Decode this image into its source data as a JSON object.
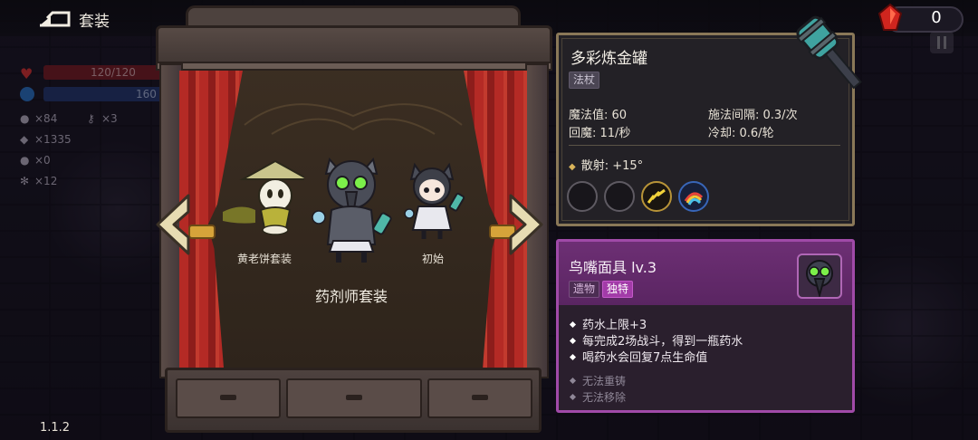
{
  "header": {
    "title": "套装",
    "gem_count": "0"
  },
  "hud": {
    "hp_text": "120/120",
    "mp_text": "160",
    "coins": "×84",
    "keys": "×3",
    "gems": "×1335",
    "potions": "×0",
    "other": "×12"
  },
  "version": "1.1.2",
  "stage": {
    "left_char_label": "黄老饼套装",
    "right_char_label": "初始",
    "current_set": "药剂师套装"
  },
  "weapon": {
    "name": "多彩炼金罐",
    "type_tag": "法杖",
    "stats": {
      "mana": "魔法值: 60",
      "cast_interval": "施法间隔: 0.3/次",
      "mana_regen": "回魔: 11/秒",
      "cooldown": "冷却: 0.6/轮"
    },
    "spread": "散射: +15°"
  },
  "relic": {
    "name": "鸟嘴面具 lv.3",
    "type_tag": "遗物",
    "rarity_tag": "独特",
    "effects": [
      "药水上限+3",
      "每完成2场战斗，得到一瓶药水",
      "喝药水会回复7点生命值"
    ],
    "notes": [
      "无法重铸",
      "无法移除"
    ]
  },
  "colors": {
    "relic_accent": "#a04aa8",
    "weapon_frame": "#8a7858",
    "hp": "#7a1e26",
    "mp": "#253a72"
  }
}
